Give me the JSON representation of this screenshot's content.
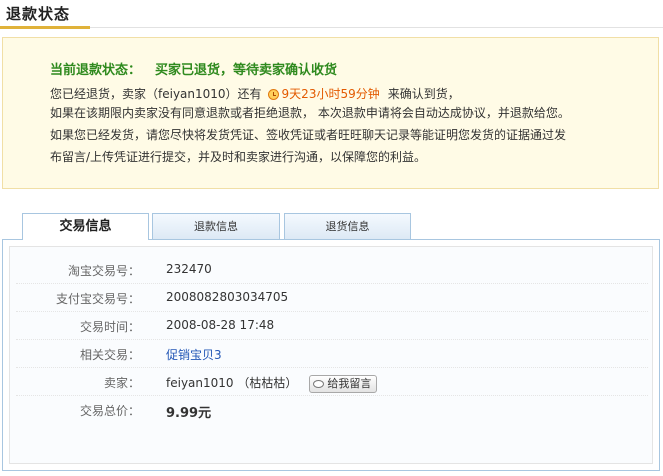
{
  "header": {
    "title": "退款状态"
  },
  "status": {
    "label": "当前退款状态：",
    "value": "买家已退货，等待卖家确认收货",
    "msg1_prefix": "您已经退货，卖家（feiyan1010）还有",
    "time_left": "9天23小时59分钟",
    "msg1_suffix": "来确认到货，",
    "msg2": "如果在该期限内卖家没有同意退款或者拒绝退款，  本次退款申请将会自动达成协议，并退款给您。",
    "msg3": "如果您已经发货，请您尽快将发货凭证、签收凭证或者旺旺聊天记录等能证明您发货的证据通过发",
    "msg4": "布留言/上传凭证进行提交，并及时和卖家进行沟通，以保障您的利益。"
  },
  "tabs": [
    {
      "label": "交易信息",
      "active": true
    },
    {
      "label": "退款信息",
      "active": false
    },
    {
      "label": "退货信息",
      "active": false
    }
  ],
  "trade": {
    "rows": [
      {
        "key": "淘宝交易号：",
        "value": "232470"
      },
      {
        "key": "支付宝交易号：",
        "value": "2008082803034705"
      },
      {
        "key": "交易时间：",
        "value": "2008-08-28 17:48"
      },
      {
        "key": "相关交易：",
        "value": "促销宝贝3"
      },
      {
        "key": "卖家：",
        "value": "feiyan1010 （枯枯枯）"
      },
      {
        "key": "交易总价：",
        "value": "9.99元"
      }
    ],
    "message_button": "给我留言"
  },
  "colors": {
    "status_green": "#2f8a1e",
    "highlight_orange": "#e35a00",
    "link_blue": "#2357b6",
    "tab_border": "#a8c6e0"
  }
}
